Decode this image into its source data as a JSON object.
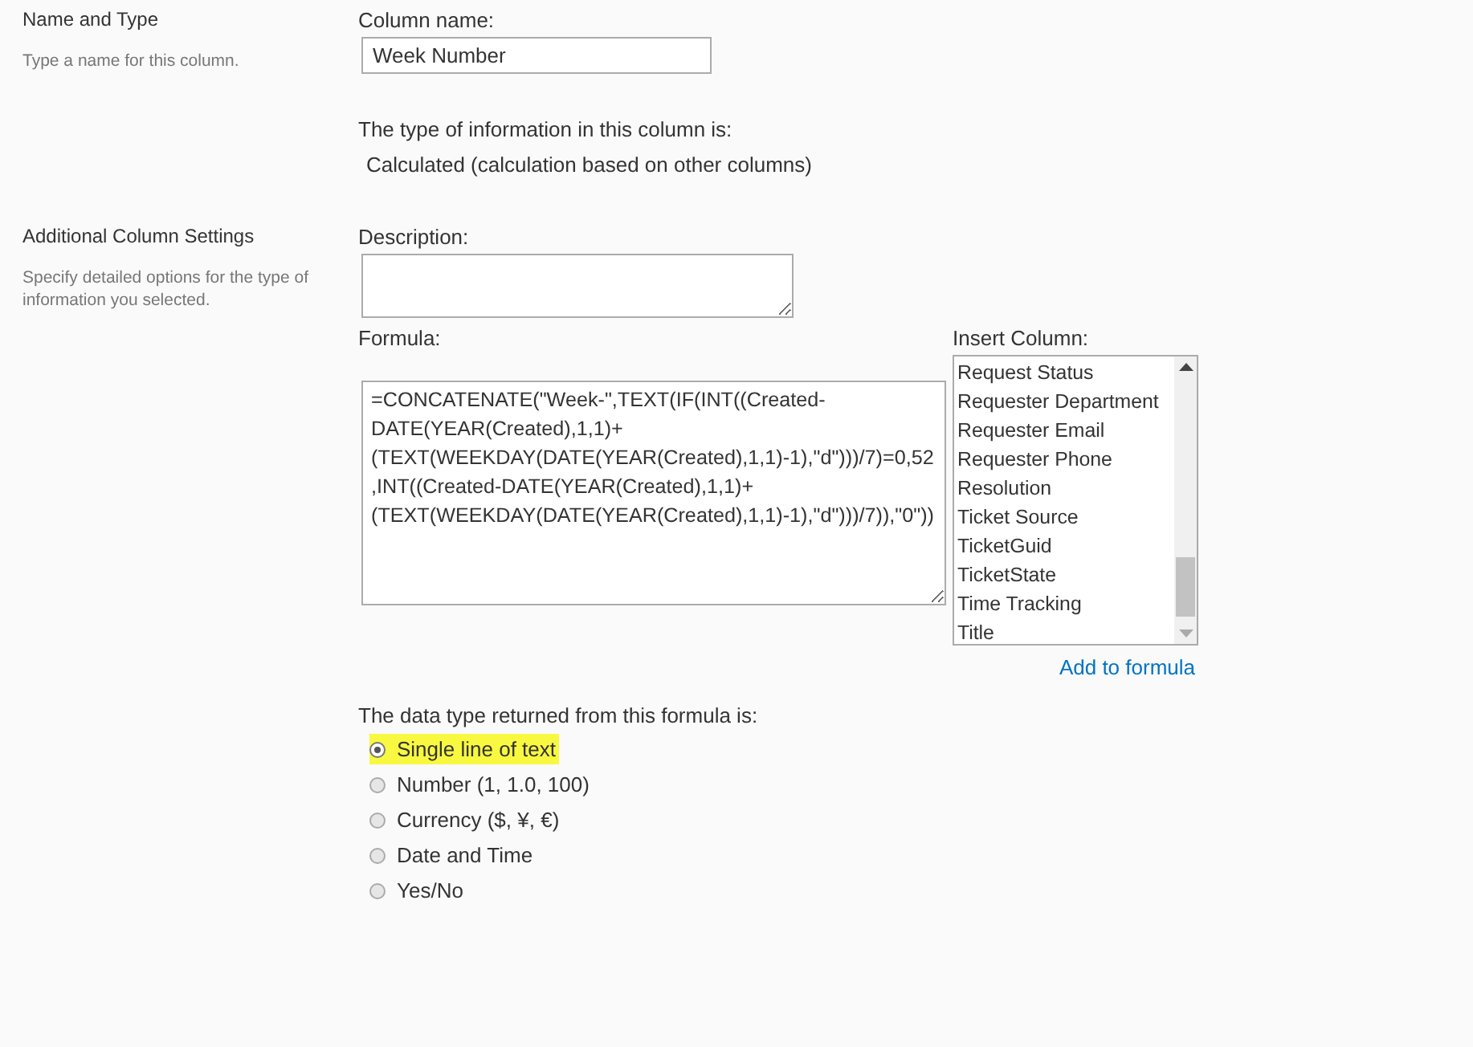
{
  "sections": [
    {
      "title": "Name and Type",
      "description": "Type a name for this column.",
      "kind": "name"
    },
    {
      "title": "Additional Column Settings",
      "description": "Specify detailed options for the type of information you selected.",
      "kind": "settings"
    }
  ],
  "column_name": {
    "label": "Column name:",
    "value": "Week Number"
  },
  "type_info": {
    "label": "The type of information in this column is:",
    "value": "Calculated (calculation based on other columns)"
  },
  "description": {
    "label": "Description:"
  },
  "formula": {
    "label": "Formula:",
    "value": "=CONCATENATE(\"Week-\",TEXT(IF(INT((Created-DATE(YEAR(Created),1,1)+(TEXT(WEEKDAY(DATE(YEAR(Created),1,1)-1),\"d\")))/7)=0,52,INT((Created-DATE(YEAR(Created),1,1)+(TEXT(WEEKDAY(DATE(YEAR(Created),1,1)-1),\"d\")))/7)),\"0\"))"
  },
  "insert_column": {
    "label": "Insert Column:",
    "items": [
      "Request Status",
      "Requester Department",
      "Requester Email",
      "Requester Phone",
      "Resolution",
      "Ticket Source",
      "TicketGuid",
      "TicketState",
      "Time Tracking",
      "Title"
    ],
    "link": "Add to formula"
  },
  "return_type": {
    "label": "The data type returned from this formula is:",
    "options": [
      {
        "label": "Single line of text",
        "selected": true
      },
      {
        "label": "Number (1, 1.0, 100)",
        "selected": false
      },
      {
        "label": "Currency ($, ¥, €)",
        "selected": false
      },
      {
        "label": "Date and Time",
        "selected": false
      },
      {
        "label": "Yes/No",
        "selected": false
      }
    ]
  }
}
